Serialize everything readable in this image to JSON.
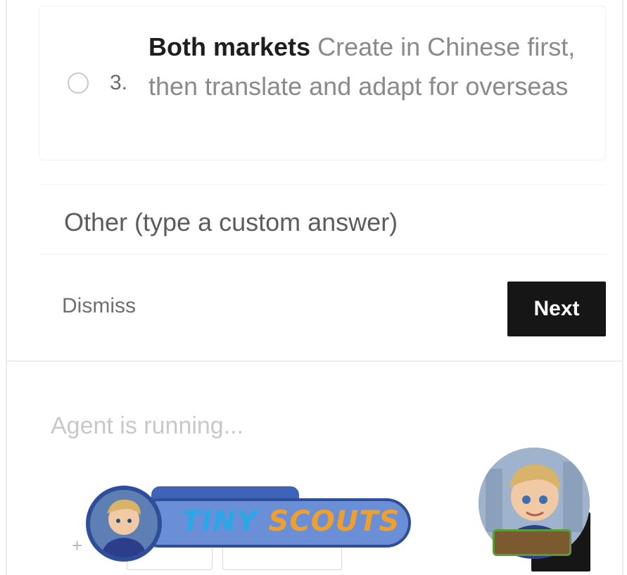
{
  "question": {
    "option": {
      "number": "3.",
      "title": "Both markets",
      "description": "Create in Chinese first, then translate and adapt for overseas"
    },
    "other_placeholder": "Other (type a custom answer)",
    "dismiss_label": "Dismiss",
    "next_label": "Next"
  },
  "composer": {
    "placeholder": "Agent is running...",
    "add_glyph": "+"
  },
  "watermark": {
    "word1": "TINY",
    "word2": "SCOUTS"
  },
  "colors": {
    "primary_button": "#161616",
    "watermark_blue": "#29a7e6",
    "watermark_orange": "#f0a02a"
  }
}
